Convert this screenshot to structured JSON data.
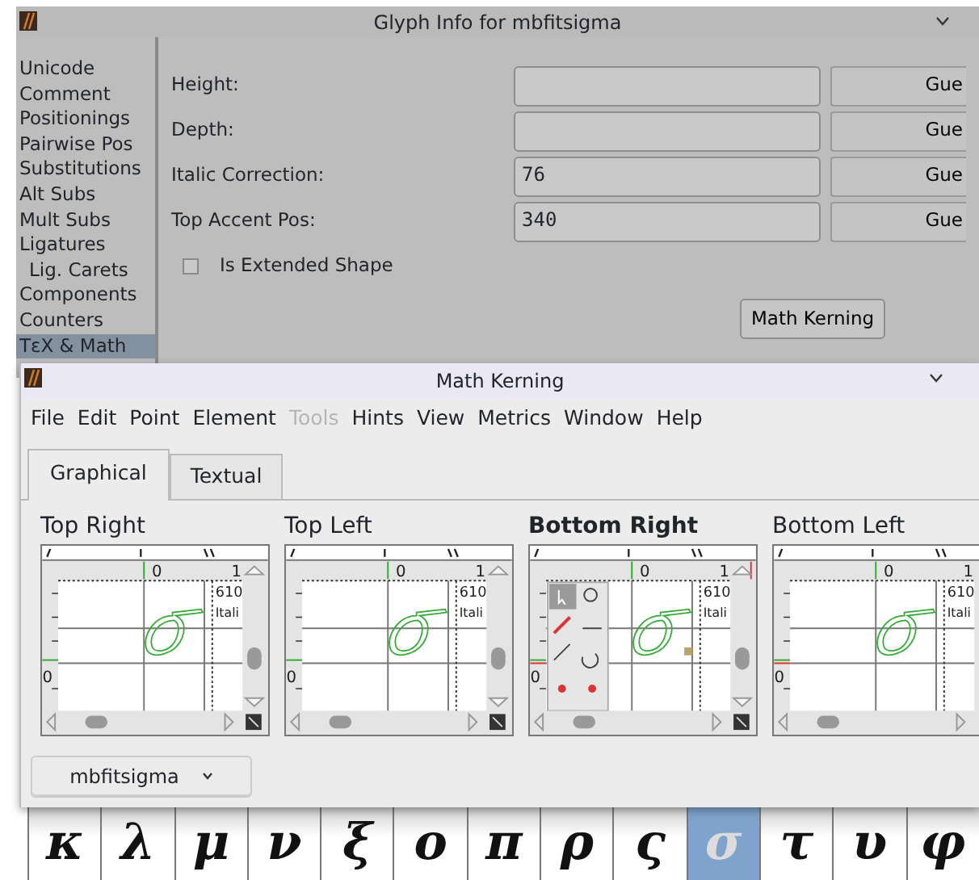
{
  "glyph_info_window": {
    "title": "Glyph Info for mbfitsigma",
    "sidebar": {
      "items": [
        {
          "label": "Unicode",
          "selected": false
        },
        {
          "label": "Comment",
          "selected": false
        },
        {
          "label": "Positionings",
          "selected": false
        },
        {
          "label": "Pairwise Pos",
          "selected": false
        },
        {
          "label": "Substitutions",
          "selected": false
        },
        {
          "label": "Alt Subs",
          "selected": false
        },
        {
          "label": "Mult Subs",
          "selected": false
        },
        {
          "label": "Ligatures",
          "selected": false,
          "children": [
            {
              "label": "Lig. Carets",
              "selected": false
            }
          ]
        },
        {
          "label": "Components",
          "selected": false
        },
        {
          "label": "Counters",
          "selected": false
        },
        {
          "label": "TεX & Math",
          "selected": true
        }
      ]
    },
    "fields": [
      {
        "label": "Height:",
        "button": "Gue"
      },
      {
        "label": "Depth:",
        "button": "Gue"
      },
      {
        "label": "Italic Correction:",
        "value": "76",
        "button": "Gue"
      },
      {
        "label": "Top Accent Pos:",
        "value": "340",
        "button": "Gue"
      }
    ],
    "extended_shape": {
      "label": "Is Extended Shape",
      "checked": false
    },
    "math_kerning_button": "Math Kerning"
  },
  "math_kerning_window": {
    "title": "Math Kerning",
    "menu": [
      {
        "label": "File",
        "disabled": false
      },
      {
        "label": "Edit",
        "disabled": false
      },
      {
        "label": "Point",
        "disabled": false
      },
      {
        "label": "Element",
        "disabled": false
      },
      {
        "label": "Tools",
        "disabled": true
      },
      {
        "label": "Hints",
        "disabled": false
      },
      {
        "label": "View",
        "disabled": false
      },
      {
        "label": "Metrics",
        "disabled": false
      },
      {
        "label": "Window",
        "disabled": false
      },
      {
        "label": "Help",
        "disabled": false
      }
    ],
    "tabs": [
      {
        "label": "Graphical",
        "selected": true
      },
      {
        "label": "Textual",
        "selected": false
      }
    ],
    "panels": [
      {
        "title": "Top Right",
        "selected": false,
        "toolbox": false,
        "kern_marks": false,
        "ruler_origin": "0",
        "ruler_next": "1",
        "width_label": "610",
        "italic_label": "Itali",
        "left_ruler_label": "0"
      },
      {
        "title": "Top Left",
        "selected": false,
        "toolbox": false,
        "kern_marks": false,
        "ruler_origin": "0",
        "ruler_next": "1",
        "width_label": "610",
        "italic_label": "Itali",
        "left_ruler_label": "0"
      },
      {
        "title": "Bottom Right",
        "selected": true,
        "toolbox": true,
        "kern_marks": true,
        "ruler_origin": "0",
        "ruler_next": "1",
        "width_label": "610",
        "italic_label": "Itali",
        "left_ruler_label": "0"
      },
      {
        "title": "Bottom Left",
        "selected": false,
        "toolbox": false,
        "kern_marks": true,
        "ruler_origin": "0",
        "ruler_next": "1",
        "width_label": "610",
        "italic_label": "Itali",
        "left_ruler_label": "0"
      }
    ],
    "glyph_select": "mbfitsigma"
  },
  "glyph_strip": [
    {
      "char": "κ",
      "selected": false
    },
    {
      "char": "λ",
      "selected": false
    },
    {
      "char": "μ",
      "selected": false
    },
    {
      "char": "ν",
      "selected": false
    },
    {
      "char": "ξ",
      "selected": false
    },
    {
      "char": "ο",
      "selected": false
    },
    {
      "char": "π",
      "selected": false
    },
    {
      "char": "ρ",
      "selected": false
    },
    {
      "char": "ς",
      "selected": false
    },
    {
      "char": "σ",
      "selected": true
    },
    {
      "char": "τ",
      "selected": false
    },
    {
      "char": "υ",
      "selected": false
    },
    {
      "char": "φ",
      "selected": false
    }
  ]
}
